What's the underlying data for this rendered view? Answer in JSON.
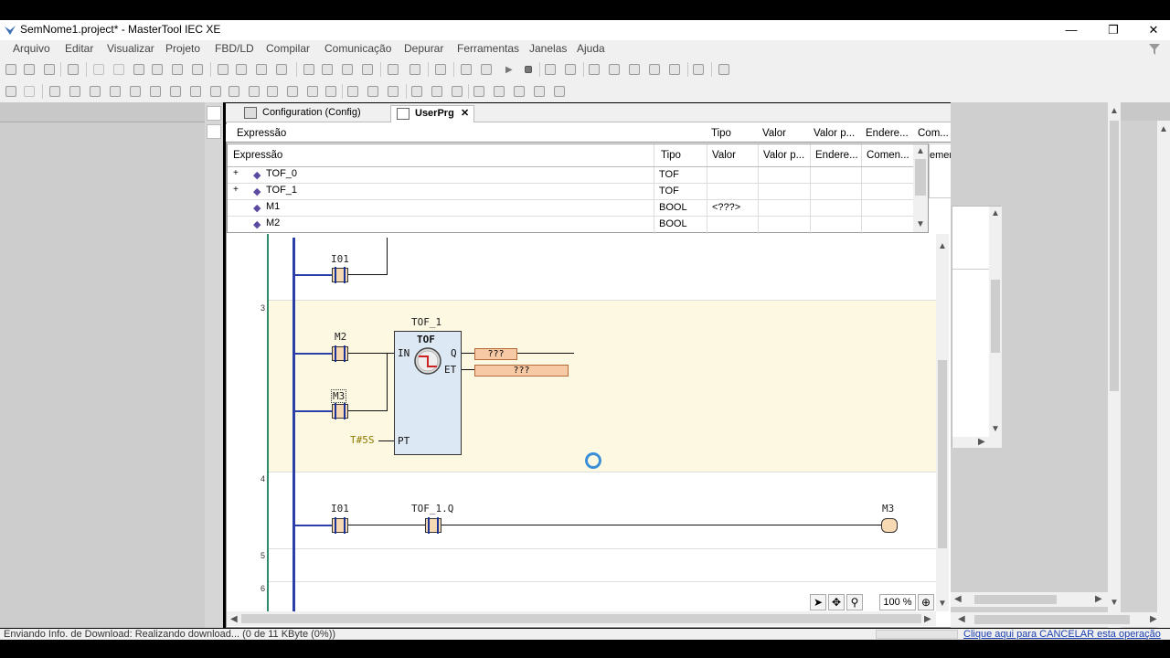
{
  "window": {
    "title": "SemNome1.project* - MasterTool IEC XE",
    "minimize": "—",
    "restore": "❐",
    "close": "✕"
  },
  "menu": [
    "Arquivo",
    "Editar",
    "Visualizar",
    "Projeto",
    "FBD/LD",
    "Compilar",
    "Comunicação",
    "Depurar",
    "Ferramentas",
    "Janelas",
    "Ajuda"
  ],
  "tabs": [
    {
      "label": "Configuration (Config)"
    },
    {
      "label": "UserPrg",
      "close": "✕"
    }
  ],
  "watch_header": {
    "expr": "Expressão",
    "type": "Tipo",
    "value": "Valor",
    "prepared": "Valor p...",
    "address": "Endere...",
    "comment": "Com..."
  },
  "var_table": {
    "headers": [
      "Expressão",
      "Tipo",
      "Valor",
      "Valor p...",
      "Endere...",
      "Comen...",
      "emen..."
    ],
    "rows": [
      {
        "expander": "+",
        "name": "TOF_0",
        "type": "TOF",
        "value": ""
      },
      {
        "expander": "+",
        "name": "TOF_1",
        "type": "TOF",
        "value": ""
      },
      {
        "expander": "",
        "name": "M1",
        "type": "BOOL",
        "value": "<???>"
      },
      {
        "expander": "",
        "name": "M2",
        "type": "BOOL",
        "value": ""
      }
    ]
  },
  "ladder": {
    "rung2": {
      "contact": "I01"
    },
    "rung3": {
      "number": "3",
      "contact1": "M2",
      "contact2": "M3",
      "fb_instance": "TOF_1",
      "fb_type": "TOF",
      "in_pin": "IN",
      "pt_pin": "PT",
      "q_pin": "Q",
      "et_pin": "ET",
      "pt_value": "T#5S",
      "q_out": "???",
      "et_out": "???"
    },
    "rung4": {
      "number": "4",
      "contact1": "I01",
      "contact2": "TOF_1.Q",
      "coil": "M3"
    },
    "rung5": {
      "number": "5"
    },
    "rung6": {
      "number": "6"
    }
  },
  "zoom": "100 %",
  "status": {
    "left": "Enviando Info. de Download: Realizando download... (0 de 11 KByte (0%))",
    "right": "Clique aqui para CANCELAR esta operação"
  }
}
